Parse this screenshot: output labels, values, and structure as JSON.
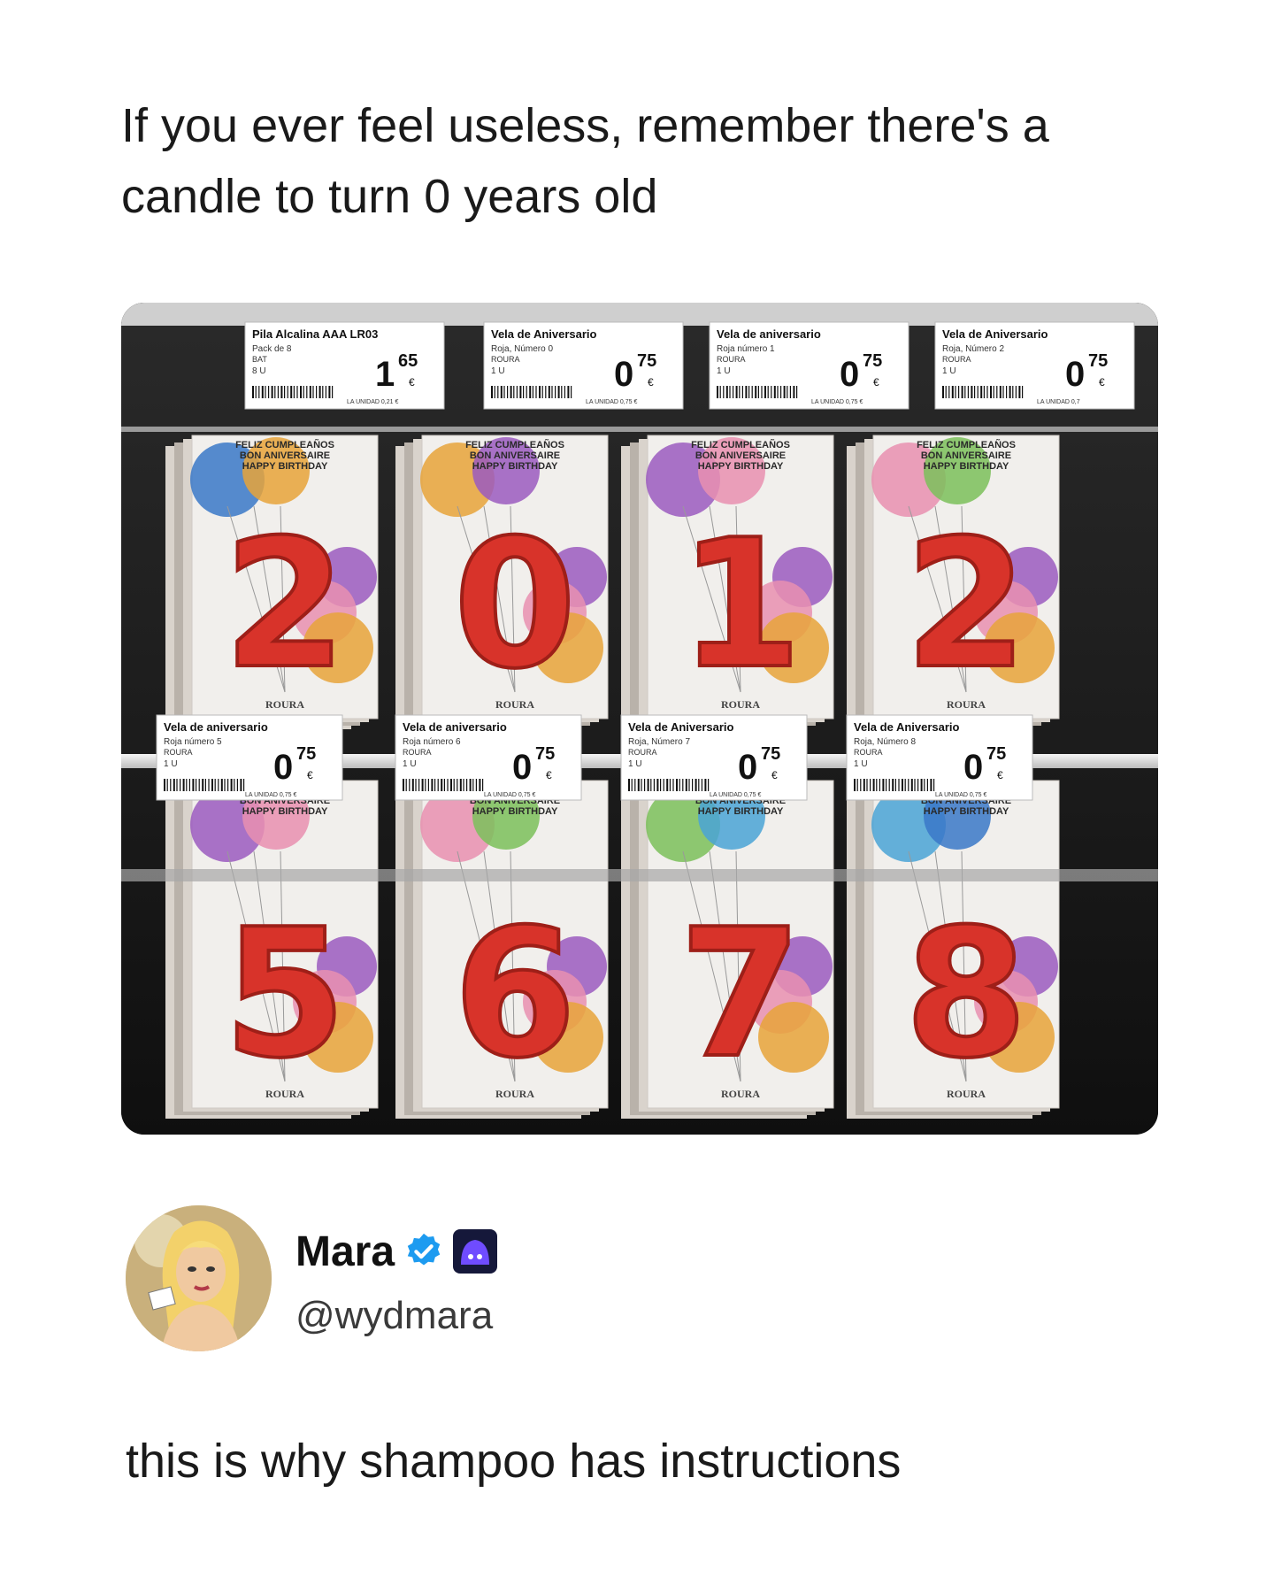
{
  "post": {
    "caption": "If you ever feel useless, remember there's a candle to turn 0 years old"
  },
  "photo": {
    "top_row": [
      {
        "title": "Pila Alcalina AAA LR03",
        "line1": "Pack de 8",
        "line2": "BAT",
        "line3": "8 U",
        "price_int": "1",
        "price_dec": "65",
        "currency": "€",
        "unit_price": "LA UNIDAD 0,21 €"
      },
      {
        "title": "Vela de Aniversario",
        "line1": "Roja, Número 0",
        "line2": "ROURA",
        "line3": "1 U",
        "price_int": "0",
        "price_dec": "75",
        "currency": "€",
        "unit_price": "LA UNIDAD 0,75 €"
      },
      {
        "title": "Vela de aniversario",
        "line1": "Roja número 1",
        "line2": "ROURA",
        "line3": "1 U",
        "price_int": "0",
        "price_dec": "75",
        "currency": "€",
        "unit_price": "LA UNIDAD 0,75 €"
      },
      {
        "title": "Vela de Aniversario",
        "line1": "Roja, Número 2",
        "line2": "ROURA",
        "line3": "1 U",
        "price_int": "0",
        "price_dec": "75",
        "currency": "€",
        "unit_price": "LA UNIDAD 0,7"
      }
    ],
    "bottom_row": [
      {
        "title": "Vela de aniversario",
        "line1": "Roja número 5",
        "line2": "ROURA",
        "line3": "1 U",
        "price_int": "0",
        "price_dec": "75",
        "currency": "€",
        "unit_price": "LA UNIDAD 0,75 €"
      },
      {
        "title": "Vela de aniversario",
        "line1": "Roja número 6",
        "line2": "ROURA",
        "line3": "1 U",
        "price_int": "0",
        "price_dec": "75",
        "currency": "€",
        "unit_price": "LA UNIDAD 0,75 €"
      },
      {
        "title": "Vela de Aniversario",
        "line1": "Roja, Número 7",
        "line2": "ROURA",
        "line3": "1 U",
        "price_int": "0",
        "price_dec": "75",
        "currency": "€",
        "unit_price": "LA UNIDAD 0,75 €"
      },
      {
        "title": "Vela de Aniversario",
        "line1": "Roja, Número 8",
        "line2": "ROURA",
        "line3": "1 U",
        "price_int": "0",
        "price_dec": "75",
        "currency": "€",
        "unit_price": "LA UNIDAD 0,75 €"
      }
    ],
    "top_digits": [
      "2",
      "0",
      "1",
      "2"
    ],
    "bottom_digits": [
      "5",
      "6",
      "7",
      "8"
    ],
    "package_header": [
      "FELIZ CUMPLEAÑOS",
      "BON ANIVERSAIRE",
      "HAPPY BIRTHDAY"
    ],
    "package_brand": "ROURA",
    "candle_color": "#d8332a"
  },
  "user": {
    "name": "Mara",
    "handle": "@wydmara",
    "verified_icon": "verified-badge-icon",
    "affiliate_icon": "affiliate-badge-icon"
  },
  "tweet": {
    "text": "this is why shampoo has instructions"
  }
}
